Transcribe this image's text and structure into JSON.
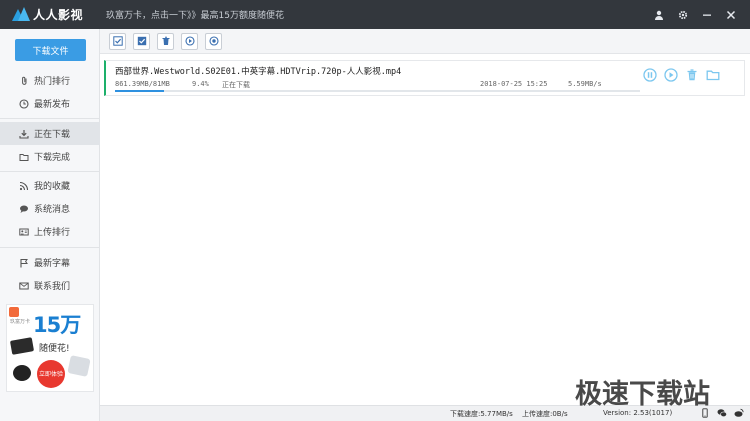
{
  "app": {
    "name": "人人影视",
    "marquee": "玖富万卡，点击一下》》最高15万额度随便花"
  },
  "sidebar": {
    "download_button": "下载文件",
    "groups": [
      [
        {
          "label": "热门排行",
          "icon": "paperclip-icon"
        },
        {
          "label": "最新发布",
          "icon": "clock-icon"
        }
      ],
      [
        {
          "label": "正在下载",
          "icon": "download-icon",
          "active": true
        },
        {
          "label": "下载完成",
          "icon": "folder-icon"
        }
      ],
      [
        {
          "label": "我的收藏",
          "icon": "rss-icon"
        },
        {
          "label": "系统消息",
          "icon": "chat-icon"
        },
        {
          "label": "上传排行",
          "icon": "id-card-icon"
        }
      ],
      [
        {
          "label": "最新字幕",
          "icon": "flag-icon"
        },
        {
          "label": "联系我们",
          "icon": "mail-icon"
        }
      ]
    ],
    "ad": {
      "brand_small": "玖富万卡",
      "headline": "15万",
      "subline": "随便花!",
      "cta": "立即体验"
    }
  },
  "toolbar": {
    "buttons": [
      "select-all-icon",
      "check-icon",
      "delete-icon",
      "start-icon",
      "pause-icon"
    ]
  },
  "tasks": [
    {
      "name": "西部世界.Westworld.S02E01.中英字幕.HDTVrip.720p-人人影视.mp4",
      "size": "861.39MB/81MB",
      "percent": "9.4%",
      "progress": 0.094,
      "status": "正在下载",
      "date": "2018-07-25 15:25",
      "speed": "5.59MB/s"
    }
  ],
  "statusbar": {
    "download_speed": "下载速度:5.77MB/s",
    "upload_speed": "上传速度:0B/s",
    "version": "Version: 2.53(1017)"
  },
  "watermark": "极速下载站",
  "colors": {
    "titlebar": "#33373d",
    "accent": "#3a9ce4",
    "progress": "#2f91e0",
    "task_border": "#1db06b",
    "action_icon": "#7cc7ef"
  }
}
